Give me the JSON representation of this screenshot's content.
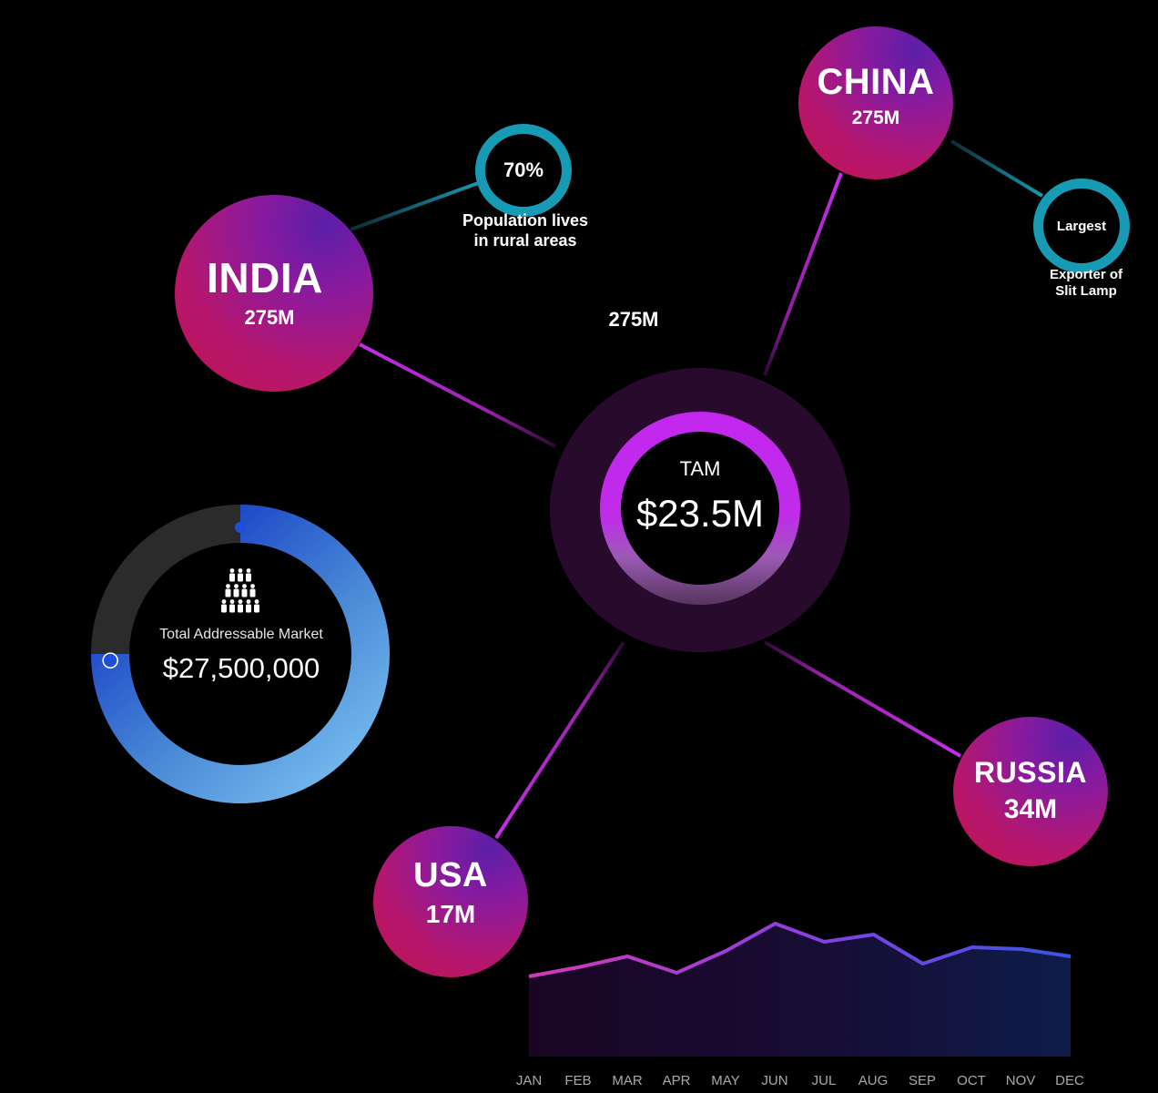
{
  "colors": {
    "background": "#000000",
    "accent_magenta": "#c227ee",
    "accent_teal": "#179bb5",
    "accent_blue": "#1f4fd6"
  },
  "countries": [
    {
      "id": "india",
      "name": "INDIA",
      "value": "275M"
    },
    {
      "id": "china",
      "name": "CHINA",
      "value": "275M"
    },
    {
      "id": "usa",
      "name": "USA",
      "value": "17M"
    },
    {
      "id": "russia",
      "name": "RUSSIA",
      "value": "34M"
    }
  ],
  "stats": {
    "rural": {
      "value": "70%",
      "caption_line1": "Population lives",
      "caption_line2": "in rural areas"
    },
    "exporter": {
      "value": "Largest",
      "caption_line1": "Exporter of",
      "caption_line2": "Slit Lamp"
    }
  },
  "floating_label": "275M",
  "tam": {
    "label": "TAM",
    "value": "$23.5M"
  },
  "market": {
    "icon": "people-pyramid-icon",
    "label": "Total Addressable Market",
    "value": "$27,500,000",
    "progress": 0.75
  },
  "chart_data": {
    "type": "area",
    "categories": [
      "JAN",
      "FEB",
      "MAR",
      "APR",
      "MAY",
      "JUN",
      "JUL",
      "AUG",
      "SEP",
      "OCT",
      "NOV",
      "DEC"
    ],
    "series": [
      {
        "values": [
          44,
          49,
          55,
          46,
          58,
          73,
          63,
          67,
          51,
          60,
          59,
          55
        ]
      }
    ],
    "ylim": [
      0,
      100
    ],
    "grid": false
  }
}
